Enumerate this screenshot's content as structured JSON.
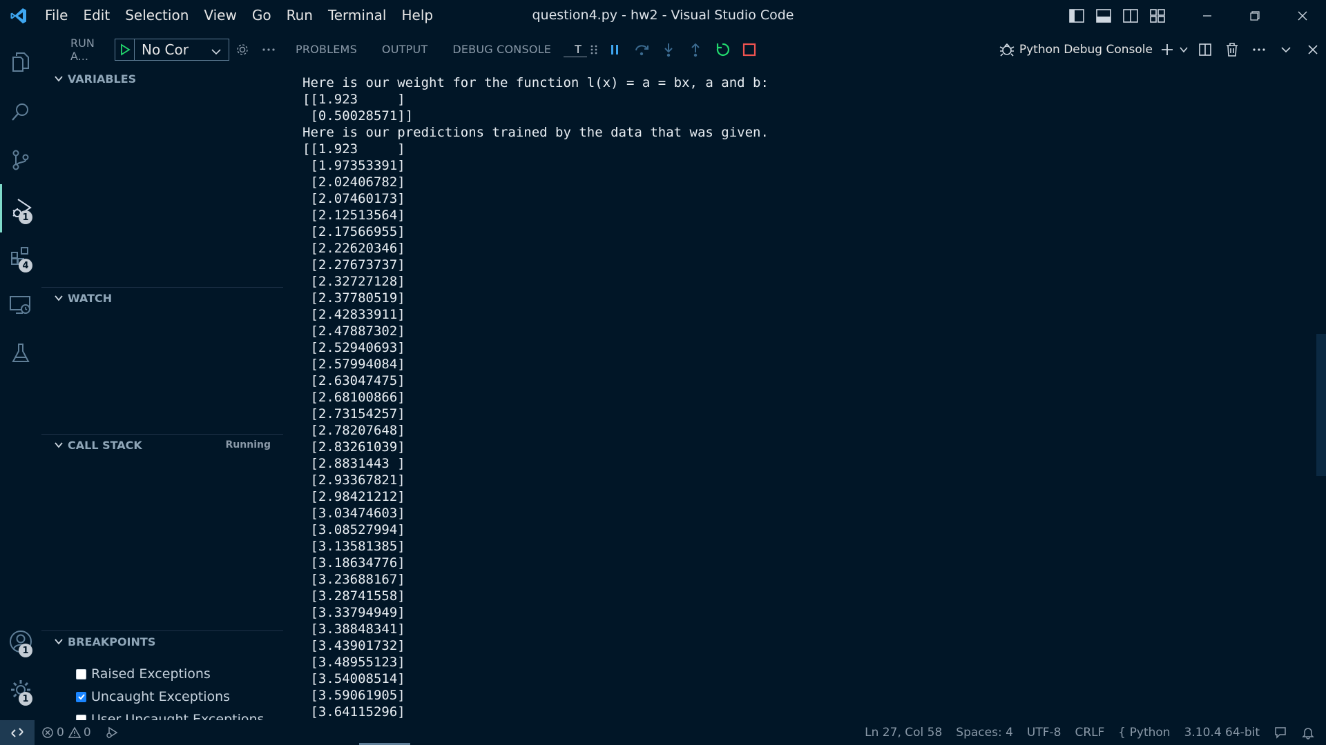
{
  "titlebar": {
    "title": "question4.py - hw2 - Visual Studio Code",
    "menu": [
      "File",
      "Edit",
      "Selection",
      "View",
      "Go",
      "Run",
      "Terminal",
      "Help"
    ]
  },
  "activity_bar": {
    "badges": {
      "run_debug": "1",
      "extensions": "4",
      "accounts": "1",
      "manage": "1"
    }
  },
  "sidebar": {
    "run_title": "RUN A...",
    "config": "No Cor",
    "sections": {
      "variables": "VARIABLES",
      "watch": "WATCH",
      "call_stack": "CALL STACK",
      "call_stack_status": "Running",
      "breakpoints": "BREAKPOINTS"
    },
    "breakpoints": [
      {
        "label": "Raised Exceptions",
        "checked": false
      },
      {
        "label": "Uncaught Exceptions",
        "checked": true
      },
      {
        "label": "User Uncaught Exceptions",
        "checked": false
      }
    ]
  },
  "panel": {
    "tabs": [
      "PROBLEMS",
      "OUTPUT",
      "DEBUG CONSOLE",
      "T"
    ],
    "console_name": "Python Debug Console"
  },
  "console_lines": [
    "Here is our weight for the function l(x) = a = bx, a and b:",
    "[[1.923     ]",
    " [0.50028571]]",
    "Here is our predictions trained by the data that was given.",
    "[[1.923     ]",
    " [1.97353391]",
    " [2.02406782]",
    " [2.07460173]",
    " [2.12513564]",
    " [2.17566955]",
    " [2.22620346]",
    " [2.27673737]",
    " [2.32727128]",
    " [2.37780519]",
    " [2.42833911]",
    " [2.47887302]",
    " [2.52940693]",
    " [2.57994084]",
    " [2.63047475]",
    " [2.68100866]",
    " [2.73154257]",
    " [2.78207648]",
    " [2.83261039]",
    " [2.8831443 ]",
    " [2.93367821]",
    " [2.98421212]",
    " [3.03474603]",
    " [3.08527994]",
    " [3.13581385]",
    " [3.18634776]",
    " [3.23688167]",
    " [3.28741558]",
    " [3.33794949]",
    " [3.38848341]",
    " [3.43901732]",
    " [3.48955123]",
    " [3.54008514]",
    " [3.59061905]",
    " [3.64115296]"
  ],
  "statusbar": {
    "errors": "0",
    "warnings": "0",
    "cursor": "Ln 27, Col 58",
    "spaces": "Spaces: 4",
    "encoding": "UTF-8",
    "eol": "CRLF",
    "language": "Python",
    "interpreter": "3.10.4 64-bit"
  },
  "colors": {
    "background": "#011627",
    "accent": "#7fdbca",
    "run_green": "#22da6e",
    "stop_red": "#ef5350",
    "checkbox_blue": "#1a85ff"
  }
}
